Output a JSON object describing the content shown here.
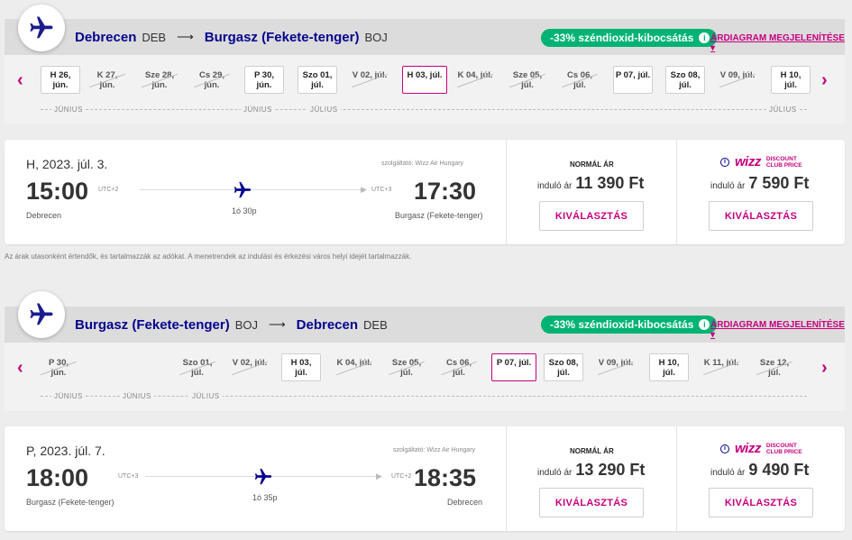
{
  "outbound": {
    "from_city": "Debrecen",
    "from_code": "DEB",
    "to_city": "Burgasz (Fekete-tenger)",
    "to_code": "BOJ",
    "co2_label": "-33% széndioxid-kibocsátás",
    "price_chart_label": "ÁRDIAGRAM MEGJELENÍTÉSE",
    "dates": [
      {
        "l1": "H 26,",
        "l2": "jún.",
        "state": "normal"
      },
      {
        "l1": "K 27,",
        "l2": "jún.",
        "state": "disabled"
      },
      {
        "l1": "Sze 28,",
        "l2": "jún.",
        "state": "disabled"
      },
      {
        "l1": "Cs 29,",
        "l2": "jún.",
        "state": "disabled"
      },
      {
        "l1": "P 30,",
        "l2": "jún.",
        "state": "normal"
      },
      {
        "l1": "Szo 01,",
        "l2": "júl.",
        "state": "normal"
      },
      {
        "l1": "V 02, júl.",
        "l2": "",
        "state": "disabled"
      },
      {
        "l1": "H 03, júl.",
        "l2": "",
        "state": "active"
      },
      {
        "l1": "K 04, júl.",
        "l2": "",
        "state": "disabled"
      },
      {
        "l1": "Sze 05,",
        "l2": "júl.",
        "state": "disabled"
      },
      {
        "l1": "Cs 06,",
        "l2": "júl.",
        "state": "disabled"
      },
      {
        "l1": "P 07, júl.",
        "l2": "",
        "state": "normal"
      },
      {
        "l1": "Szo 08,",
        "l2": "júl.",
        "state": "normal"
      },
      {
        "l1": "V 09, júl.",
        "l2": "",
        "state": "disabled"
      },
      {
        "l1": "H 10,",
        "l2": "júl.",
        "state": "normal"
      }
    ],
    "months": [
      "JÚNIUS",
      "JÚNIUS",
      "JÚLIUS",
      "JÚLIUS"
    ],
    "flight": {
      "date": "H, 2023. júl. 3.",
      "provider": "szolgáltató: Wizz Air Hungary",
      "dep_time": "15:00",
      "dep_utc": "UTC+2",
      "dep_city": "Debrecen",
      "arr_time": "17:30",
      "arr_utc": "UTC+3",
      "arr_city": "Burgasz (Fekete-tenger)",
      "duration": "1ó 30p",
      "normal_title": "NORMÁL ÁR",
      "from_label": "induló ár",
      "normal_price": "11 390 Ft",
      "club_price": "7 590 Ft",
      "select_label": "KIVÁLASZTÁS"
    }
  },
  "return": {
    "from_city": "Burgasz (Fekete-tenger)",
    "from_code": "BOJ",
    "to_city": "Debrecen",
    "to_code": "DEB",
    "co2_label": "-33% széndioxid-kibocsátás",
    "price_chart_label": "ÁRDIAGRAM MEGJELENÍTÉSE",
    "dates": [
      {
        "l1": "P 30,",
        "l2": "jún.",
        "state": "disabled"
      },
      {
        "l1": "Szo 01,",
        "l2": "júl.",
        "state": "disabled"
      },
      {
        "l1": "V 02, júl.",
        "l2": "",
        "state": "disabled"
      },
      {
        "l1": "H 03,",
        "l2": "júl.",
        "state": "normal"
      },
      {
        "l1": "K 04, júl.",
        "l2": "",
        "state": "disabled"
      },
      {
        "l1": "Sze 05,",
        "l2": "júl.",
        "state": "disabled"
      },
      {
        "l1": "Cs 06,",
        "l2": "júl.",
        "state": "disabled"
      },
      {
        "l1": "P 07, júl.",
        "l2": "",
        "state": "active"
      },
      {
        "l1": "Szo 08,",
        "l2": "júl.",
        "state": "normal"
      },
      {
        "l1": "V 09, júl.",
        "l2": "",
        "state": "disabled"
      },
      {
        "l1": "H 10,",
        "l2": "júl.",
        "state": "normal"
      },
      {
        "l1": "K 11, júl.",
        "l2": "",
        "state": "disabled"
      },
      {
        "l1": "Sze 12,",
        "l2": "júl.",
        "state": "disabled"
      }
    ],
    "months": [
      "JÚNIUS",
      "JÚNIUS",
      "JÚLIUS"
    ],
    "flight": {
      "date": "P, 2023. júl. 7.",
      "provider": "szolgáltató: Wizz Air Hungary",
      "dep_time": "18:00",
      "dep_utc": "UTC+3",
      "dep_city": "Burgasz (Fekete-tenger)",
      "arr_time": "18:35",
      "arr_utc": "UTC+2",
      "arr_city": "Debrecen",
      "duration": "1ó 35p",
      "normal_title": "NORMÁL ÁR",
      "from_label": "induló ár",
      "normal_price": "13 290 Ft",
      "club_price": "9 490 Ft",
      "select_label": "KIVÁLASZTÁS"
    }
  },
  "club_logo": {
    "wordmark": "wizz",
    "line1": "DISCOUNT",
    "line2": "CLUB PRICE"
  },
  "disclaimer": "Az árak utasonként értendők, és tartalmazzák az adókat. A menetrendek az indulási és érkezési város helyi idejét tartalmazzák.",
  "colors": {
    "brand_navy": "#06038d",
    "brand_magenta": "#c6007e",
    "co2_green": "#00b373"
  }
}
